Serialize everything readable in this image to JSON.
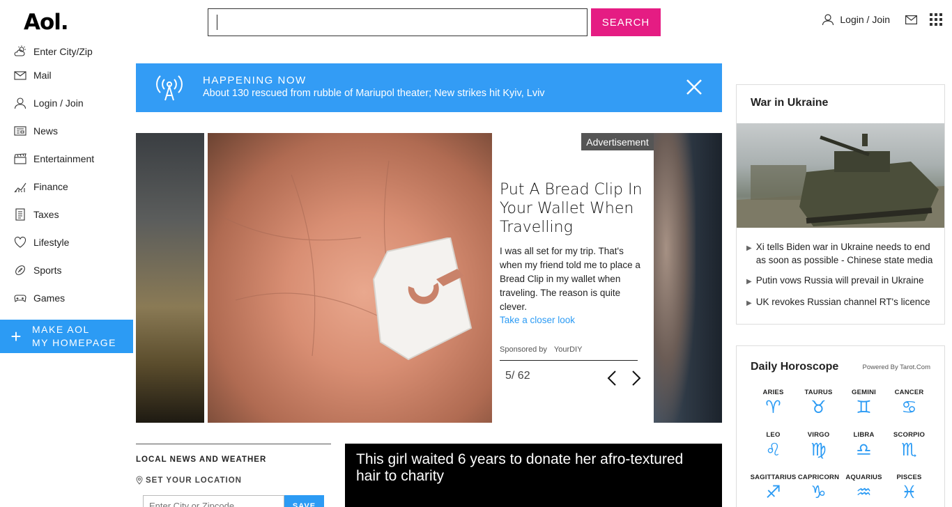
{
  "header": {
    "logo": "Aol.",
    "search_placeholder": "",
    "search_button": "SEARCH",
    "login": "Login / Join"
  },
  "sidebar": {
    "items": [
      {
        "label": "Enter City/Zip",
        "icon": "weather-icon"
      },
      {
        "label": "Mail",
        "icon": "mail-icon"
      },
      {
        "label": "Login / Join",
        "icon": "user-icon"
      },
      {
        "label": "News",
        "icon": "news-icon"
      },
      {
        "label": "Entertainment",
        "icon": "clapperboard-icon"
      },
      {
        "label": "Finance",
        "icon": "chart-icon"
      },
      {
        "label": "Taxes",
        "icon": "document-icon"
      },
      {
        "label": "Lifestyle",
        "icon": "heart-icon"
      },
      {
        "label": "Sports",
        "icon": "ball-icon"
      },
      {
        "label": "Games",
        "icon": "gamepad-icon"
      }
    ],
    "make_home": [
      "MAKE AOL",
      "MY HOMEPAGE"
    ]
  },
  "happening": {
    "title": "HAPPENING NOW",
    "text": "About 130 rescued from rubble of Mariupol theater; New strikes hit Kyiv, Lviv"
  },
  "carousel": {
    "ad_label": "Advertisement",
    "title": "Put A Bread Clip In Your Wallet When Travelling",
    "description": "I was all set for my trip. That's when my friend told me to place a Bread Clip in my wallet when traveling. The reason is quite clever.",
    "link": "Take a closer look",
    "sponsored_by": "Sponsored by",
    "sponsor": "YourDIY",
    "counter": "5/ 62"
  },
  "local": {
    "title": "LOCAL NEWS AND WEATHER",
    "set_location": "SET YOUR LOCATION",
    "input_placeholder": "Enter City or Zipcode",
    "save": "SAVE"
  },
  "video": {
    "title": "This girl waited 6 years to donate her afro-textured hair to charity"
  },
  "war": {
    "title": "War in Ukraine",
    "headlines": [
      "Xi tells Biden war in Ukraine needs to end as soon as possible - Chinese state media",
      "Putin vows Russia will prevail in Ukraine",
      "UK revokes Russian channel RT's licence"
    ]
  },
  "horoscope": {
    "title": "Daily Horoscope",
    "powered": "Powered By Tarot.Com",
    "signs": [
      {
        "name": "ARIES",
        "glyph": "♈"
      },
      {
        "name": "TAURUS",
        "glyph": "♉"
      },
      {
        "name": "GEMINI",
        "glyph": "♊"
      },
      {
        "name": "CANCER",
        "glyph": "♋"
      },
      {
        "name": "LEO",
        "glyph": "♌"
      },
      {
        "name": "VIRGO",
        "glyph": "♍"
      },
      {
        "name": "LIBRA",
        "glyph": "♎"
      },
      {
        "name": "SCORPIO",
        "glyph": "♏"
      },
      {
        "name": "SAGITTARIUS",
        "glyph": "♐"
      },
      {
        "name": "CAPRICORN",
        "glyph": "♑"
      },
      {
        "name": "AQUARIUS",
        "glyph": "♒"
      },
      {
        "name": "PISCES",
        "glyph": "♓"
      }
    ]
  },
  "colors": {
    "accent_blue": "#2c9bf4",
    "search_pink": "#e51c83"
  }
}
